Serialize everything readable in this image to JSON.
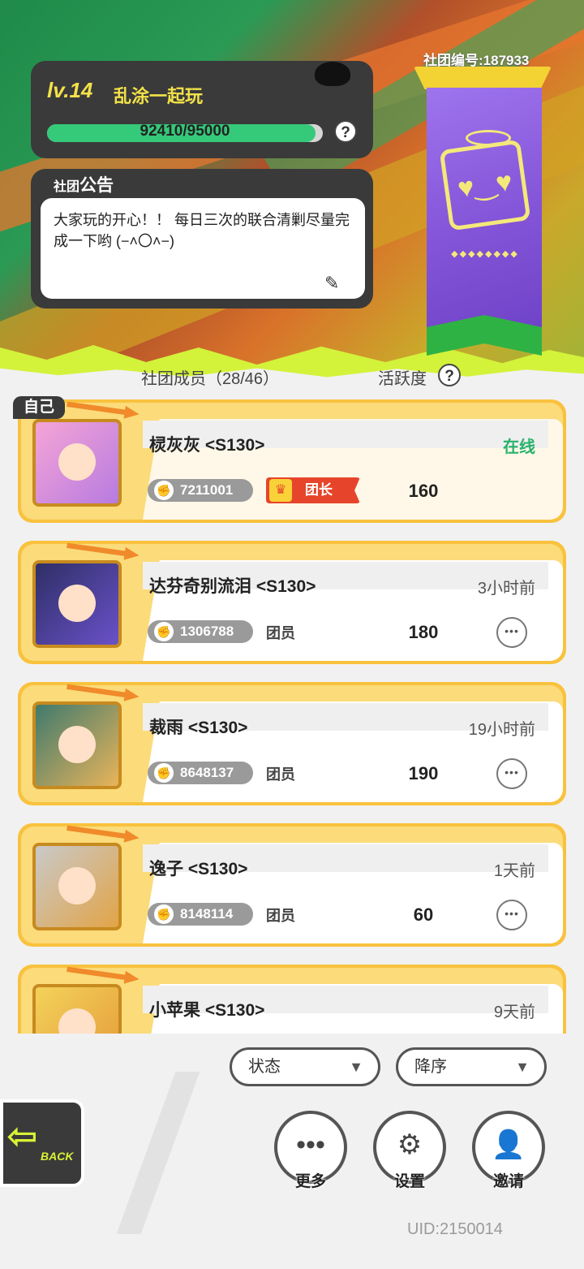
{
  "header": {
    "level": "lv.14",
    "club_name": "乱涂一起玩",
    "xp": {
      "text": "92410/95000",
      "current": 92410,
      "max": 95000
    },
    "help": "?",
    "club_id": "社团编号:187933"
  },
  "notice": {
    "title_prefix": "社团",
    "title": "公告",
    "text": "大家玩的开心！！ 每日三次的联合清剿尽量完成一下哟 (−˄〇˄−)",
    "edit_icon": "pencil-icon"
  },
  "members_header": {
    "label": "社团成员（28/46）",
    "activity_label": "活跃度",
    "help": "?"
  },
  "self_tag": "自己",
  "members": [
    {
      "name": "棂灰灰 <S130>",
      "status": "在线",
      "power": "7211001",
      "role": "团长",
      "activity": "160"
    },
    {
      "name": "达芬奇别流泪 <S130>",
      "status": "3小时前",
      "power": "1306788",
      "role": "团员",
      "activity": "180"
    },
    {
      "name": "裁雨 <S130>",
      "status": "19小时前",
      "power": "8648137",
      "role": "团员",
      "activity": "190"
    },
    {
      "name": "逸子 <S130>",
      "status": "1天前",
      "power": "8148114",
      "role": "团员",
      "activity": "60"
    },
    {
      "name": "小苹果 <S130>",
      "status": "9天前"
    }
  ],
  "filters": {
    "status": "状态",
    "order": "降序",
    "chevron": "▼"
  },
  "back": {
    "label": "BACK",
    "icon": "back-arrow-icon"
  },
  "actions": {
    "more": "更多",
    "settings": "设置",
    "invite": "邀请"
  },
  "more_dots": "•••",
  "uid": "UID:2150014",
  "colors": {
    "accent_yellow": "#f9c23e",
    "online_green": "#27b26a",
    "leader_red": "#e6452b",
    "xp_green": "#35c97a",
    "lime": "#d3f23a",
    "banner_purple": "#8455d8"
  }
}
